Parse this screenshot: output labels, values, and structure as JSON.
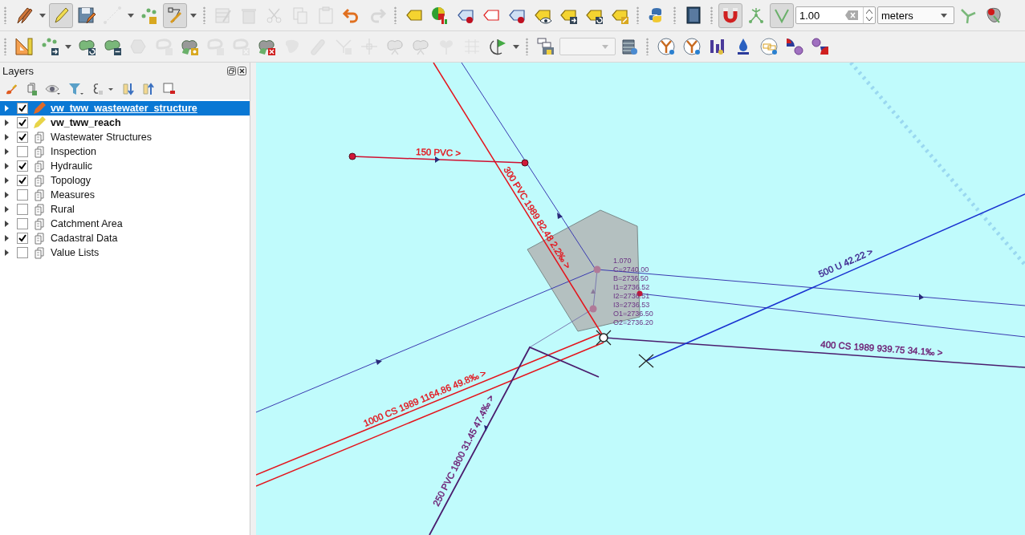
{
  "toolbar": {
    "rows": [
      [
        [
          {
            "kind": "pencils",
            "disabled": false,
            "pressed": false
          },
          {
            "kind": "dropdown-arrow"
          },
          {
            "kind": "pencil",
            "disabled": false,
            "pressed": true
          },
          {
            "kind": "floppy-disk",
            "disabled": false,
            "pressed": false
          },
          {
            "kind": "dashed-line",
            "disabled": true,
            "pressed": false
          },
          {
            "kind": "dropdown-arrow"
          },
          {
            "kind": "dots",
            "disabled": false,
            "pressed": false
          },
          {
            "kind": "node-tools",
            "disabled": false,
            "pressed": true
          },
          {
            "kind": "dropdown-arrow"
          }
        ],
        [
          {
            "kind": "table",
            "disabled": true,
            "pressed": false
          },
          {
            "kind": "trash-can",
            "disabled": true,
            "pressed": false
          },
          {
            "kind": "scissors",
            "disabled": true,
            "pressed": false
          },
          {
            "kind": "copy",
            "disabled": true,
            "pressed": false
          },
          {
            "kind": "clipboard",
            "disabled": true,
            "pressed": false
          },
          {
            "kind": "undo",
            "disabled": false,
            "pressed": false
          },
          {
            "kind": "redo",
            "disabled": true,
            "pressed": false
          }
        ],
        [
          {
            "kind": "label-tag",
            "disabled": false,
            "pressed": false
          },
          {
            "kind": "pie-chart",
            "disabled": false,
            "pressed": false
          },
          {
            "kind": "label-pin",
            "disabled": false,
            "pressed": false
          },
          {
            "kind": "label-outline",
            "disabled": false,
            "pressed": false
          },
          {
            "kind": "label-pin",
            "disabled": false,
            "pressed": false
          },
          {
            "kind": "label-eye",
            "disabled": false,
            "pressed": false
          },
          {
            "kind": "label-move",
            "disabled": false,
            "pressed": false
          },
          {
            "kind": "label-rotate",
            "disabled": false,
            "pressed": false
          },
          {
            "kind": "label-edit",
            "disabled": false,
            "pressed": false
          }
        ],
        [
          {
            "kind": "snakes",
            "disabled": false,
            "pressed": false
          }
        ],
        [
          {
            "kind": "help",
            "disabled": false,
            "pressed": false
          }
        ],
        [
          {
            "kind": "magnet",
            "disabled": false,
            "pressed": true
          },
          {
            "kind": "vertex-tree",
            "disabled": false,
            "pressed": false
          },
          {
            "kind": "angle",
            "disabled": false,
            "pressed": true
          },
          {
            "kind": "tolerance-field",
            "value": "1.00"
          },
          {
            "kind": "units-combo",
            "value": "meters"
          },
          {
            "kind": "branch",
            "disabled": false,
            "pressed": false
          },
          {
            "kind": "map-pin",
            "disabled": false,
            "pressed": false
          }
        ]
      ],
      [
        [
          {
            "kind": "set-square",
            "disabled": false,
            "pressed": false
          },
          {
            "kind": "dots-arrow",
            "disabled": false,
            "pressed": false
          },
          {
            "kind": "dropdown-arrow"
          },
          {
            "kind": "blob-rotate",
            "disabled": false,
            "pressed": false
          },
          {
            "kind": "blob-resize",
            "disabled": false,
            "pressed": false
          },
          {
            "kind": "hexagon",
            "disabled": true,
            "pressed": false
          },
          {
            "kind": "ring-gear",
            "disabled": true,
            "pressed": false
          },
          {
            "kind": "blob-gear",
            "disabled": false,
            "pressed": false
          },
          {
            "kind": "ring-gear",
            "disabled": true,
            "pressed": false
          },
          {
            "kind": "ring-delete",
            "disabled": true,
            "pressed": false
          },
          {
            "kind": "blob-delete",
            "disabled": false,
            "pressed": false
          },
          {
            "kind": "blob",
            "disabled": true,
            "pressed": false
          },
          {
            "kind": "capsule",
            "disabled": true,
            "pressed": false
          },
          {
            "kind": "vertex-line",
            "disabled": true,
            "pressed": false
          },
          {
            "kind": "cross-nodes",
            "disabled": true,
            "pressed": false
          },
          {
            "kind": "split",
            "disabled": true,
            "pressed": false
          },
          {
            "kind": "split",
            "disabled": true,
            "pressed": false
          },
          {
            "kind": "merge",
            "disabled": true,
            "pressed": false
          },
          {
            "kind": "offset-lines",
            "disabled": true,
            "pressed": false
          },
          {
            "kind": "rotate-flag",
            "disabled": false,
            "pressed": false
          },
          {
            "kind": "dropdown-arrow"
          }
        ],
        [
          {
            "kind": "database-layer",
            "disabled": false,
            "pressed": false
          },
          {
            "kind": "layer-combo"
          },
          {
            "kind": "database-gear",
            "disabled": false,
            "pressed": false
          }
        ],
        [
          {
            "kind": "network-circle",
            "disabled": false,
            "pressed": false
          },
          {
            "kind": "network-circle",
            "disabled": false,
            "pressed": false
          },
          {
            "kind": "bars-drop",
            "disabled": false,
            "pressed": false
          },
          {
            "kind": "drop",
            "disabled": false,
            "pressed": false
          },
          {
            "kind": "chain",
            "disabled": false,
            "pressed": false
          },
          {
            "kind": "node-in",
            "disabled": false,
            "pressed": false
          },
          {
            "kind": "node-out",
            "disabled": false,
            "pressed": false
          }
        ]
      ]
    ]
  },
  "layers_panel": {
    "title": "Layers",
    "layers": [
      {
        "name": "vw_tww_wastewater_structure",
        "kind": "editing",
        "color": "#e06a28",
        "checked": true,
        "selected": true,
        "bold": true
      },
      {
        "name": "vw_tww_reach",
        "kind": "editing",
        "color": "#e8d448",
        "checked": true,
        "selected": false,
        "bold": true
      },
      {
        "name": "Wastewater Structures",
        "kind": "group",
        "checked": true,
        "selected": false,
        "bold": false
      },
      {
        "name": "Inspection",
        "kind": "group",
        "checked": false,
        "selected": false,
        "bold": false
      },
      {
        "name": "Hydraulic",
        "kind": "group",
        "checked": true,
        "selected": false,
        "bold": false
      },
      {
        "name": "Topology",
        "kind": "group",
        "checked": true,
        "selected": false,
        "bold": false
      },
      {
        "name": "Measures",
        "kind": "group",
        "checked": false,
        "selected": false,
        "bold": false
      },
      {
        "name": "Rural",
        "kind": "group",
        "checked": false,
        "selected": false,
        "bold": false
      },
      {
        "name": "Catchment Area",
        "kind": "group",
        "checked": false,
        "selected": false,
        "bold": false
      },
      {
        "name": "Cadastral Data",
        "kind": "group",
        "checked": true,
        "selected": false,
        "bold": false
      },
      {
        "name": "Value Lists",
        "kind": "group",
        "checked": false,
        "selected": false,
        "bold": false
      }
    ]
  },
  "map": {
    "labels": [
      {
        "text": "150 PVC >",
        "color": "#e4141c"
      },
      {
        "text": "300 PVC 1989 82.48 2.2‰ >",
        "color": "#e4141c"
      },
      {
        "text": "500 U 42.22 >",
        "color": "#3a1f8c"
      },
      {
        "text": "400 CS 1989 939.75 34.1‰ >",
        "color": "#6a1870"
      },
      {
        "text": "1000 CS 1989 1164.86 49.8‰ >",
        "color": "#e4141c"
      },
      {
        "text": "250 PVC 1800 31.45 47.4‰ >",
        "color": "#6a1870"
      }
    ],
    "node_attributes": [
      "1.070",
      "C=2740.00",
      "B=2736.50",
      "I1=2736.52",
      "I2=2736.51",
      "I3=2736.53",
      "O1=2736.50",
      "O2=2736.20"
    ]
  }
}
